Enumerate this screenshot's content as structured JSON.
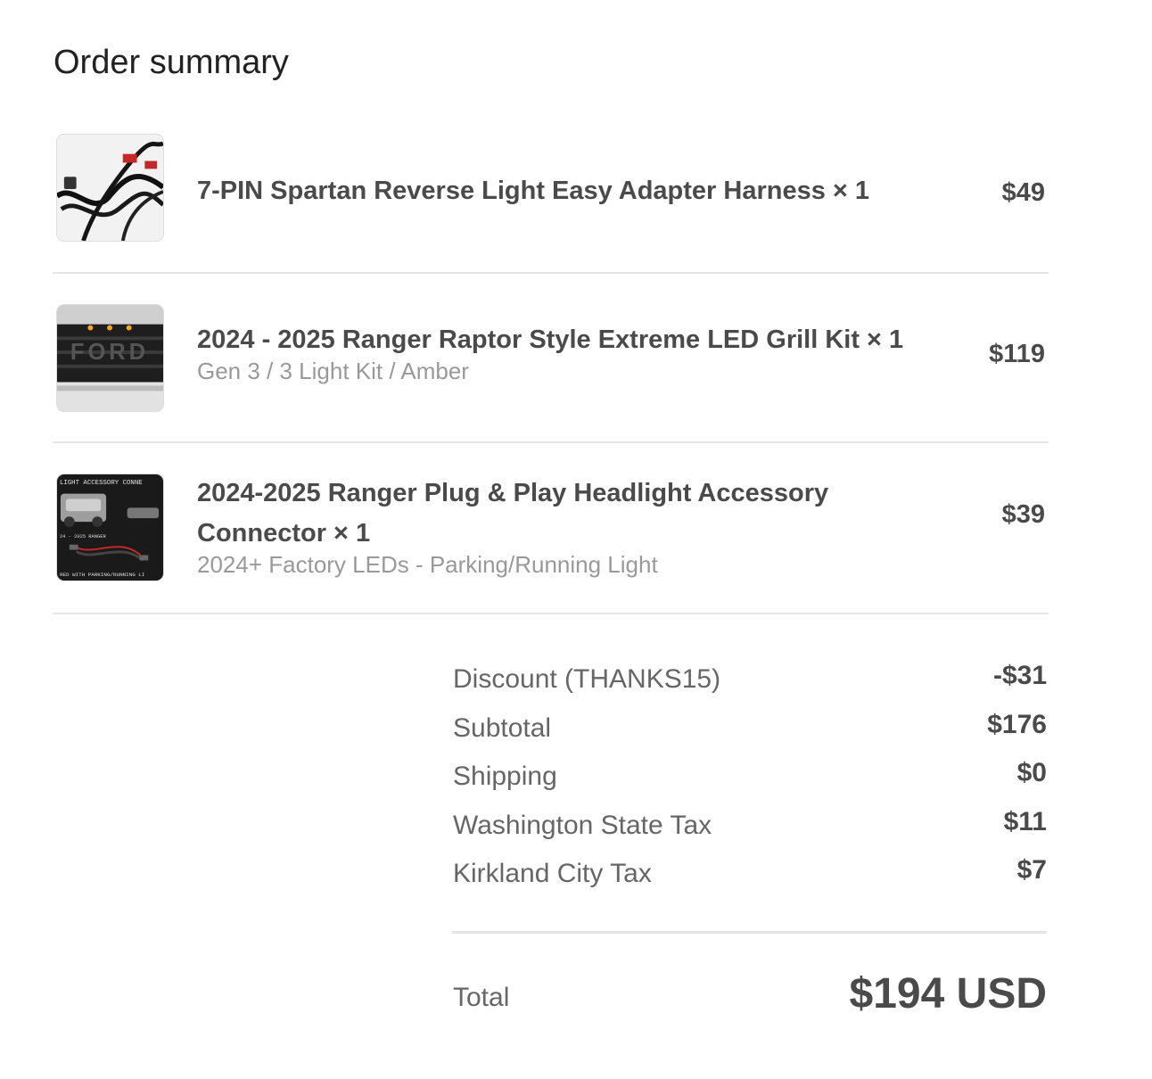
{
  "page": {
    "title": "Order summary"
  },
  "items": [
    {
      "title": "7-PIN Spartan Reverse Light Easy Adapter Harness × 1",
      "variant": "",
      "price": "$49",
      "thumbnail_icon": "wiring-harness-image"
    },
    {
      "title": "2024 - 2025 Ranger Raptor Style Extreme LED Grill Kit × 1",
      "variant": "Gen 3 / 3 Light Kit / Amber",
      "price": "$119",
      "thumbnail_icon": "grill-kit-image"
    },
    {
      "title": "2024-2025 Ranger Plug & Play Headlight Accessory Connector × 1",
      "variant": "2024+ Factory LEDs - Parking/Running Light",
      "price": "$39",
      "thumbnail_icon": "headlight-connector-image"
    }
  ],
  "summary": {
    "discount": {
      "label": "Discount (THANKS15)",
      "value": "-$31"
    },
    "subtotal": {
      "label": "Subtotal",
      "value": "$176"
    },
    "shipping": {
      "label": "Shipping",
      "value": "$0"
    },
    "state_tax": {
      "label": "Washington State Tax",
      "value": "$11"
    },
    "city_tax": {
      "label": "Kirkland City Tax",
      "value": "$7"
    }
  },
  "total": {
    "label": "Total",
    "value": "$194 USD"
  },
  "thumbnail_text": {
    "connector_banner": "LIGHT ACCESSORY CONNE",
    "connector_model": "24 - 2025 RANGER",
    "connector_footer": "RED WITH PARKING/RUNNING LI"
  },
  "colors": {
    "text_dark": "#4a4a4a",
    "text_muted": "#999999",
    "divider": "#e5e5e5",
    "amber_light": "#f5a623"
  }
}
